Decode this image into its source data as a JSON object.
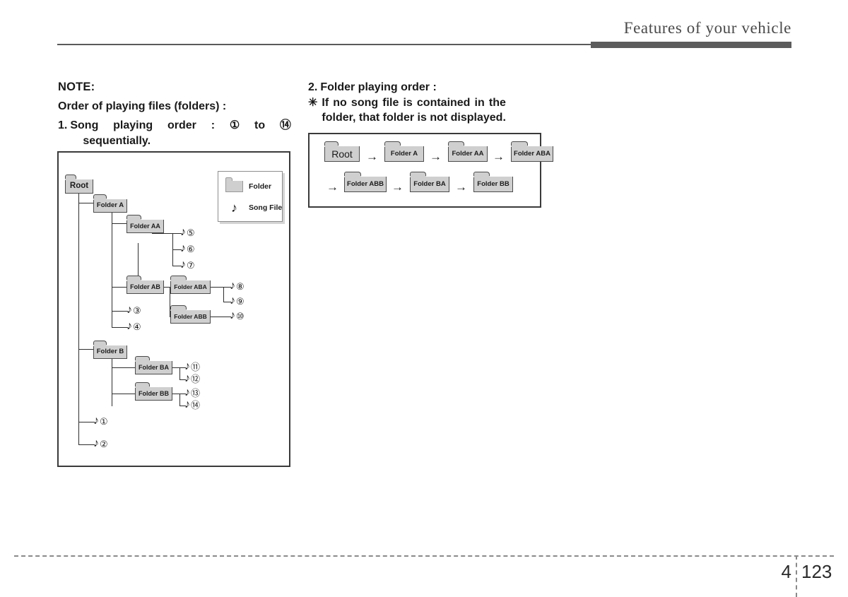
{
  "header": {
    "title": "Features of your vehicle"
  },
  "footer": {
    "chapter": "4",
    "page": "123"
  },
  "left_column": {
    "note_label": "NOTE:",
    "subtitle": "Order of playing files (folders) :",
    "item_number": "1.",
    "item_line1_words": [
      "Song",
      "playing",
      "order",
      ":",
      "①",
      "to",
      "⑭"
    ],
    "item_line2": "sequentially."
  },
  "right_column": {
    "item_number": "2.",
    "item_title": "Folder playing order :",
    "star_marker": "✳",
    "star_line1_words": [
      "If",
      "no",
      "song",
      "file",
      "is",
      "contained",
      "in",
      "the"
    ],
    "star_line2": "folder, that folder is not displayed."
  },
  "legend": {
    "folder_label": "Folder",
    "song_label": "Song File",
    "note_glyph": "♪"
  },
  "tree": {
    "folders": [
      {
        "label": "Root",
        "level": 0
      },
      {
        "label": "Folder A",
        "level": 1
      },
      {
        "label": "Folder AA",
        "level": 2
      },
      {
        "label": "Folder AB",
        "level": 2
      },
      {
        "label": "Folder ABA",
        "level": 3
      },
      {
        "label": "Folder ABB",
        "level": 3
      },
      {
        "label": "Folder B",
        "level": 1
      },
      {
        "label": "Folder BA",
        "level": 2
      },
      {
        "label": "Folder BB",
        "level": 2
      }
    ],
    "songs": [
      {
        "index": "①",
        "parent": "Root"
      },
      {
        "index": "②",
        "parent": "Root"
      },
      {
        "index": "③",
        "parent": "Folder A"
      },
      {
        "index": "④",
        "parent": "Folder A"
      },
      {
        "index": "⑤",
        "parent": "Folder AA"
      },
      {
        "index": "⑥",
        "parent": "Folder AA"
      },
      {
        "index": "⑦",
        "parent": "Folder AA"
      },
      {
        "index": "⑧",
        "parent": "Folder ABA"
      },
      {
        "index": "⑨",
        "parent": "Folder ABA"
      },
      {
        "index": "⑩",
        "parent": "Folder ABB"
      },
      {
        "index": "⑪",
        "parent": "Folder BA"
      },
      {
        "index": "⑫",
        "parent": "Folder BA"
      },
      {
        "index": "⑬",
        "parent": "Folder BB"
      },
      {
        "index": "⑭",
        "parent": "Folder BB"
      }
    ],
    "note_glyph": "♪"
  },
  "flow": {
    "arrow_glyph": "→",
    "row1": [
      "Root",
      "Folder A",
      "Folder AA",
      "Folder ABA"
    ],
    "row2": [
      "Folder ABB",
      "Folder BA",
      "Folder BB"
    ]
  },
  "colors": {
    "folder_fill": "#cfcfcf",
    "folder_border": "#4b4b4b",
    "header_bar": "#5c5c5c",
    "rule": "#5a5a5a"
  }
}
